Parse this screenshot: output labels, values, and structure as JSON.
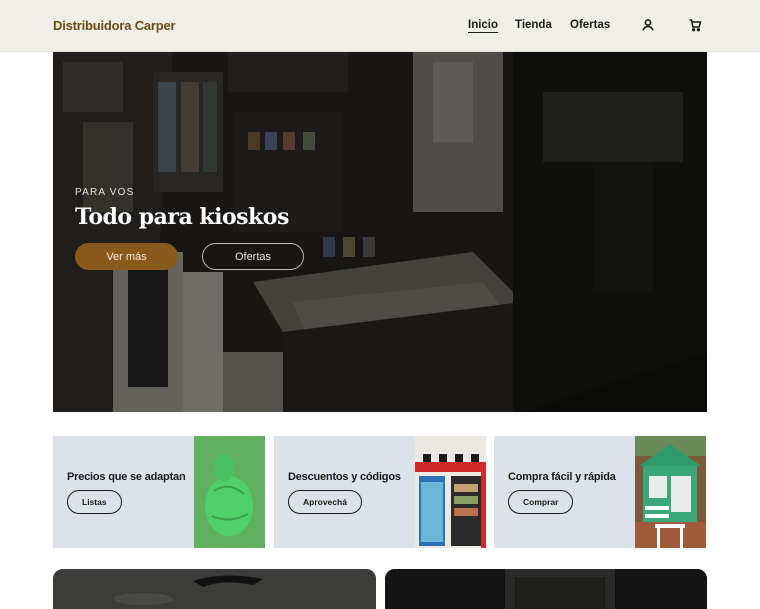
{
  "header": {
    "brand": "Distribuidora Carper",
    "nav": [
      {
        "label": "Inicio",
        "active": true
      },
      {
        "label": "Tienda",
        "active": false
      },
      {
        "label": "Ofertas",
        "active": false
      }
    ],
    "icons": [
      "user-icon",
      "cart-icon"
    ]
  },
  "hero": {
    "kicker": "PARA VOS",
    "title": "Todo para kioskos",
    "primary_button": "Ver más",
    "secondary_button": "Ofertas"
  },
  "cards": [
    {
      "title": "Precios que se adaptan",
      "button": "Listas"
    },
    {
      "title": "Descuentos y códigos",
      "button": "Aprovechá"
    },
    {
      "title": "Compra fácil y rápida",
      "button": "Comprar"
    }
  ],
  "colors": {
    "brand": "#6b4a16",
    "header_bg": "#efefe7",
    "primary_button": "#8a5a1c",
    "card_bg": "#dde2ea"
  }
}
